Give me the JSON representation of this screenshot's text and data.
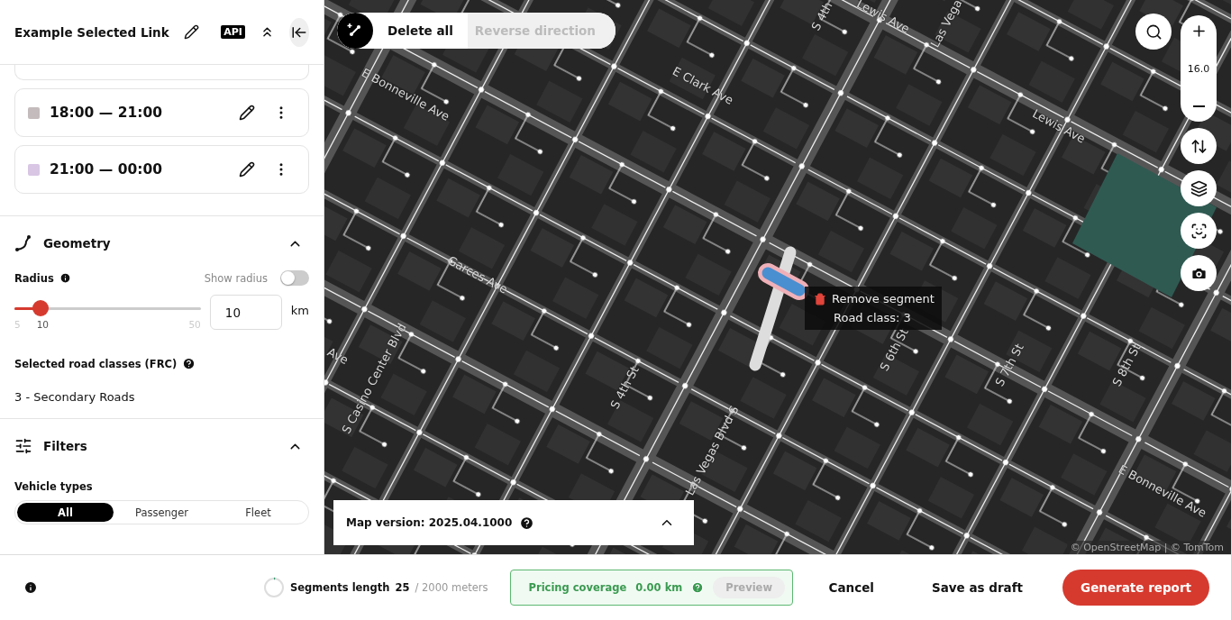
{
  "header": {
    "title": "Example Selected Link",
    "badge": "API"
  },
  "time_slots": [
    {
      "label": "18:00 — 21:00",
      "color": "#c4bcbc"
    },
    {
      "label": "21:00 — 00:00",
      "color": "#d8c6e4"
    }
  ],
  "geometry": {
    "title": "Geometry",
    "expanded": true,
    "radius_label": "Radius",
    "show_radius_label": "Show radius",
    "show_radius": false,
    "level": 0.14,
    "min": "5",
    "value_label": "10",
    "max": "50",
    "input_value": "10",
    "unit": "km",
    "road_classes_label": "Selected road classes (FRC)",
    "road_classes_value": "3 - Secondary Roads"
  },
  "filters": {
    "title": "Filters",
    "expanded": true,
    "vehicle_label": "Vehicle types",
    "vehicle_types": [
      {
        "label": "All",
        "selected": true
      },
      {
        "label": "Passenger",
        "selected": false
      },
      {
        "label": "Fleet",
        "selected": false
      }
    ]
  },
  "map_toolbar": {
    "actions": [
      {
        "label": "Delete all",
        "disabled": false
      },
      {
        "label": "Reverse direction",
        "disabled": true
      }
    ]
  },
  "zoom": "16.0",
  "street_labels": [
    "E Bonneville Ave",
    "E Clark Ave",
    "Lewis Ave",
    "Las Vega",
    "S 4th",
    "Lewis Ave",
    "Garces Ave",
    "S Casino Center Blvd",
    "Ave",
    "S 4th St",
    "Las Vegas Blvd S",
    "S 6th St",
    "S 7th St",
    "S 8th St",
    "E Bonneville Ave"
  ],
  "segment_tooltip": {
    "action": "Remove segment",
    "info": "Road class: 3"
  },
  "map_version": {
    "label": "Map version: 2025.04.1000",
    "expanded": false
  },
  "attribution": "© OpenStreetMap | © TomTom",
  "footer": {
    "segments_label": "Segments length",
    "segments_value": "25",
    "segments_total": "/ 2000 meters",
    "level": 0.02,
    "pricing_label": "Pricing coverage",
    "pricing_value": "0.00 km",
    "preview": {
      "label": "Preview",
      "disabled": true
    },
    "buttons": [
      {
        "label": "Cancel",
        "kind": "text"
      },
      {
        "label": "Save as draft",
        "kind": "text"
      },
      {
        "label": "Generate report",
        "kind": "primary"
      }
    ]
  }
}
